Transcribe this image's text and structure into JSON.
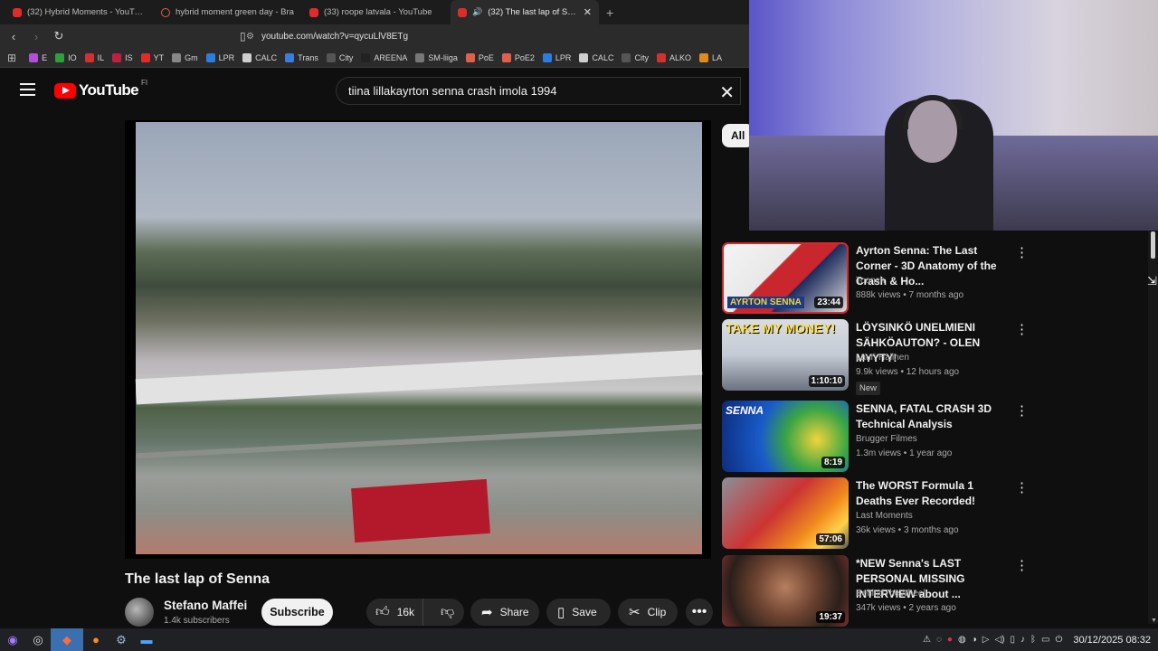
{
  "browser": {
    "tabs": [
      {
        "label": "(32) Hybrid Moments - YouTube",
        "active": false,
        "icon": "youtube-icon"
      },
      {
        "label": "hybrid moment green day - Bra",
        "active": false,
        "icon": "brave-icon"
      },
      {
        "label": "(33) roope latvala - YouTube",
        "active": false,
        "icon": "youtube-icon"
      },
      {
        "label": "(32) The last lap of Senna",
        "active": true,
        "icon": "youtube-icon"
      }
    ],
    "new_tab": "+",
    "url": "youtube.com/watch?v=qycuLlV8ETg",
    "bookmarks": [
      {
        "label": "E",
        "color": "#b04fd8"
      },
      {
        "label": "IO",
        "color": "#2e9e3e"
      },
      {
        "label": "IL",
        "color": "#d33030"
      },
      {
        "label": "IS",
        "color": "#c02040"
      },
      {
        "label": "YT",
        "color": "#e02b2b"
      },
      {
        "label": "Gm",
        "color": "#888888"
      },
      {
        "label": "LPR",
        "color": "#2b7de0"
      },
      {
        "label": "CALC",
        "color": "#cfcfcf"
      },
      {
        "label": "Trans",
        "color": "#3b7ddd"
      },
      {
        "label": "City",
        "color": "#555555"
      },
      {
        "label": "AREENA",
        "color": "#222222"
      },
      {
        "label": "SM-liiga",
        "color": "#777777"
      },
      {
        "label": "PoE",
        "color": "#e0604a"
      },
      {
        "label": "PoE2",
        "color": "#e0604a"
      },
      {
        "label": "LPR",
        "color": "#2b7de0"
      },
      {
        "label": "CALC",
        "color": "#cfcfcf"
      },
      {
        "label": "City",
        "color": "#555555"
      },
      {
        "label": "ALKO",
        "color": "#d33030"
      },
      {
        "label": "LA",
        "color": "#e08a20"
      }
    ]
  },
  "youtube": {
    "logo_text": "YouTube",
    "country_code": "FI",
    "search_value": "tiina lillakayrton senna crash imola 1994",
    "video_title": "The last lap of Senna",
    "channel_name": "Stefano Maffei",
    "subscribers": "1.4k subscribers",
    "subscribe_label": "Subscribe",
    "likes": "16k",
    "share_label": "Share",
    "save_label": "Save",
    "clip_label": "Clip",
    "chip_all": "All",
    "recommendations": [
      {
        "title": "Ayrton Senna: The Last Corner - 3D Anatomy of the Crash & Ho...",
        "channel": "Toonch",
        "meta": "888k views • 7 months ago",
        "duration": "23:44",
        "thumb_text": "AYRTON SENNA",
        "badge": ""
      },
      {
        "title": "LÖYSINKÖ UNELMIENI SÄHKÖAUTON? - OLEN MYYTY!",
        "channel": "Lauri Halinen",
        "meta": "9.9k views • 12 hours ago",
        "duration": "1:10:10",
        "thumb_text": "TAKE MY MONEY!",
        "badge": "New"
      },
      {
        "title": "SENNA, FATAL CRASH 3D Technical Analysis",
        "channel": "Brugger Filmes",
        "meta": "1.3m views • 1 year ago",
        "duration": "8:19",
        "thumb_text": "SENNA",
        "badge": ""
      },
      {
        "title": "The WORST Formula 1 Deaths Ever Recorded!",
        "channel": "Last Moments",
        "meta": "36k views • 3 months ago",
        "duration": "57:06",
        "thumb_text": "",
        "badge": ""
      },
      {
        "title": "*NEW Senna's LAST PERSONAL MISSING INTERVIEW about ...",
        "channel": "BehindTheWheel",
        "meta": "347k views • 2 years ago",
        "duration": "19:37",
        "thumb_text": "",
        "badge": ""
      }
    ]
  },
  "taskbar": {
    "clock": "30/12/2025 08:32"
  }
}
